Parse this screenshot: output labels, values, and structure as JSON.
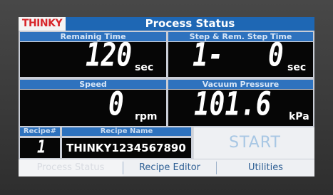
{
  "header": {
    "logo": "THINKY",
    "title": "Process Status"
  },
  "remaining_time": {
    "label": "Remainig Time",
    "value": "120",
    "unit": "sec"
  },
  "step": {
    "label": "Step & Rem. Step Time",
    "step_value": "1-",
    "time_value": "0",
    "unit": "sec"
  },
  "speed": {
    "label": "Speed",
    "value": "0",
    "unit": "rpm"
  },
  "vacuum": {
    "label": "Vacuum Pressure",
    "value": "101.6",
    "unit": "kPa"
  },
  "recipe": {
    "number_label": "Recipe#",
    "number_value": "1",
    "name_label": "Recipe Name",
    "name_value": "THINKY1234567890"
  },
  "start_button": {
    "label": "START"
  },
  "tabs": [
    {
      "label": "Process Status",
      "active": true
    },
    {
      "label": "Recipe Editor",
      "active": false
    },
    {
      "label": "Utilities",
      "active": false
    }
  ],
  "colors": {
    "panel_header": "#2e72be",
    "title_bar": "#1e67b4",
    "display_bg": "#060606",
    "logo_red": "#d8262a"
  }
}
